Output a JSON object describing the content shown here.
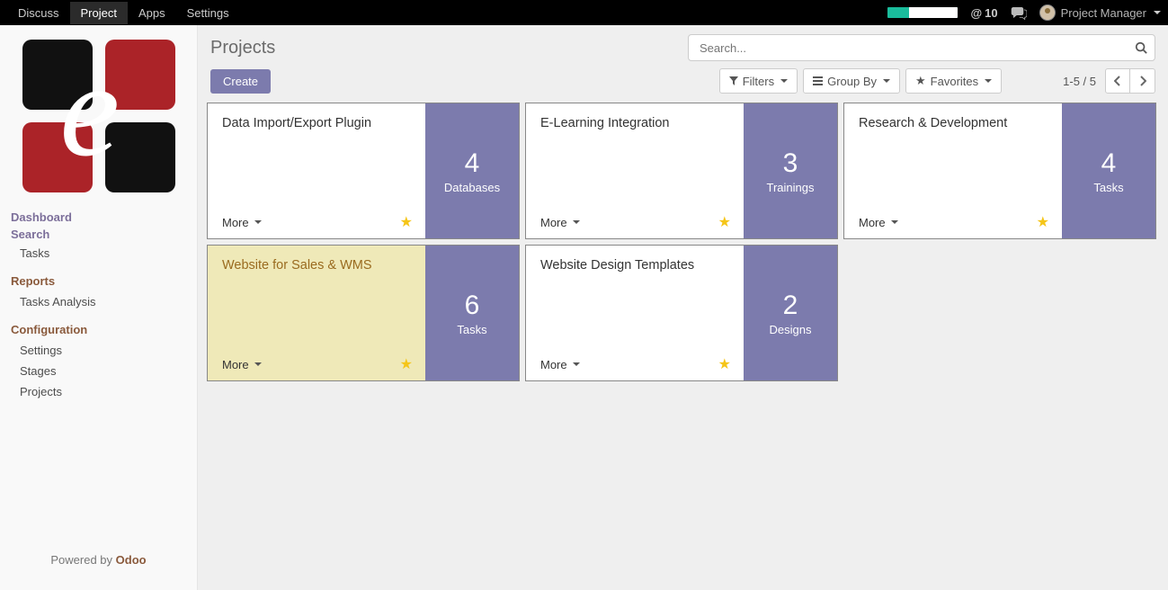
{
  "navbar": {
    "items": [
      "Discuss",
      "Project",
      "Apps",
      "Settings"
    ],
    "active_index": 1,
    "mention_count": "10",
    "user_name": "Project Manager"
  },
  "sidebar": {
    "dashboard_label": "Dashboard",
    "search_label": "Search",
    "search_items": [
      "Tasks"
    ],
    "reports_label": "Reports",
    "reports_items": [
      "Tasks Analysis"
    ],
    "config_label": "Configuration",
    "config_items": [
      "Settings",
      "Stages",
      "Projects"
    ],
    "footer_prefix": "Powered by ",
    "footer_brand": "Odoo"
  },
  "header": {
    "title": "Projects",
    "search_placeholder": "Search...",
    "create_label": "Create",
    "filters_label": "Filters",
    "groupby_label": "Group By",
    "favorites_label": "Favorites",
    "range_label": "1-5 / 5"
  },
  "projects": [
    {
      "title": "Data Import/Export Plugin",
      "count": "4",
      "unit": "Databases",
      "selected": false,
      "starred": true
    },
    {
      "title": "E-Learning Integration",
      "count": "3",
      "unit": "Trainings",
      "selected": false,
      "starred": true
    },
    {
      "title": "Research & Development",
      "count": "4",
      "unit": "Tasks",
      "selected": false,
      "starred": true
    },
    {
      "title": "Website for Sales & WMS",
      "count": "6",
      "unit": "Tasks",
      "selected": true,
      "starred": true
    },
    {
      "title": "Website Design Templates",
      "count": "2",
      "unit": "Designs",
      "selected": false,
      "starred": true
    }
  ],
  "card_more_label": "More"
}
